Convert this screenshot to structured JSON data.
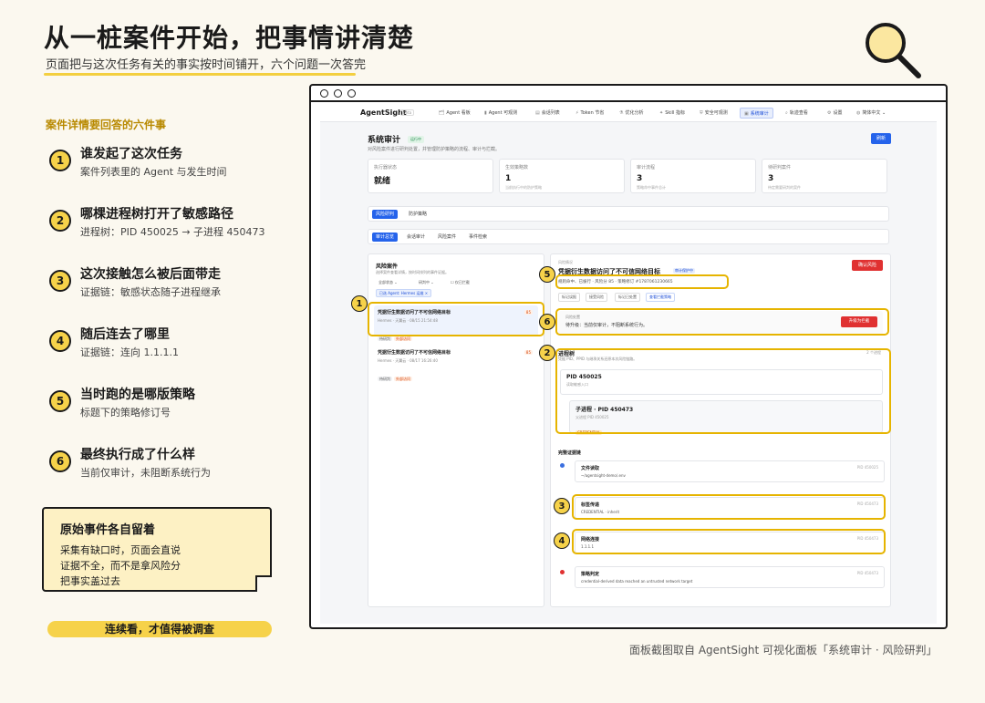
{
  "header": {
    "title": "从一桩案件开始，把事情讲清楚",
    "subtitle": "页面把与这次任务有关的事实按时间铺开，六个问题一次答完"
  },
  "questions": {
    "heading": "案件详情要回答的六件事",
    "items": [
      {
        "num": "1",
        "title": "谁发起了这次任务",
        "desc": "案件列表里的 Agent 与发生时间"
      },
      {
        "num": "2",
        "title": "哪棵进程树打开了敏感路径",
        "desc": "进程树：PID 450025 → 子进程 450473"
      },
      {
        "num": "3",
        "title": "这次接触怎么被后面带走",
        "desc": "证据链：敏感状态随子进程继承"
      },
      {
        "num": "4",
        "title": "随后连去了哪里",
        "desc": "证据链：连向 1.1.1.1"
      },
      {
        "num": "5",
        "title": "当时跑的是哪版策略",
        "desc": "标题下的策略修订号"
      },
      {
        "num": "6",
        "title": "最终执行成了什么样",
        "desc": "当前仅审计，未阻断系统行为"
      }
    ]
  },
  "note": {
    "title": "原始事件各自留着",
    "body": "采集有缺口时，页面会直说\n证据不全，而不是拿风险分\n把事实盖过去"
  },
  "pill": "连续看，才值得被调查",
  "caption": "面板截图取自 AgentSight 可视化面板「系统审计 · 风险研判」",
  "app": {
    "brand": "AgentSight",
    "brand_badge": "beta",
    "nav": [
      {
        "icon": "🗂",
        "label": "Agent 看板"
      },
      {
        "icon": "▮",
        "label": "Agent 可观测"
      },
      {
        "icon": "▤",
        "label": "会话列表"
      },
      {
        "icon": "⚡",
        "label": "Token 节省"
      },
      {
        "icon": "⚗",
        "label": "优化分析"
      },
      {
        "icon": "✦",
        "label": "Skill 指标"
      },
      {
        "icon": "⛨",
        "label": "安全可观测"
      },
      {
        "icon": "▣",
        "label": "系统审计"
      },
      {
        "icon": "⌕",
        "label": "轨迹查看"
      },
      {
        "icon": "⚙",
        "label": "设置"
      },
      {
        "icon": "◍",
        "label": "简体中文"
      }
    ],
    "page_title": "系统审计",
    "status_tag": "运行中",
    "page_desc": "对风险案件进行研判处置，并管理防护策略的流程、审计与拦截。",
    "refresh": "刷新",
    "stats": [
      {
        "label": "执行器状态",
        "value": "就绪",
        "sub": ""
      },
      {
        "label": "生效策略数",
        "value": "1",
        "sub": "当前执行中的防护策略"
      },
      {
        "label": "审计流程",
        "value": "3",
        "sub": "策略命中事件总计"
      },
      {
        "label": "待研判案件",
        "value": "3",
        "sub": "待定需要研判的案件"
      }
    ],
    "tabs1": [
      "风险研判",
      "防护策略"
    ],
    "tabs2": [
      "审计总览",
      "会话审计",
      "风险案件",
      "事件检索"
    ],
    "left": {
      "title": "风险案件",
      "desc": "选择案件查看详情，按时间排列的事件证据。",
      "filters": [
        "全部状态",
        "研判中"
      ],
      "checkbox": "仅已拦截",
      "chip": "已选 Agent: Hermes 运维 ×",
      "cases": [
        {
          "title": "凭据衍生数据访问了不可信网络目标",
          "meta": "Hermes · 天翼云 · 08/15 21:54:48",
          "tag1": "待研判",
          "tag2": "外部访问",
          "score": "85"
        },
        {
          "title": "凭据衍生数据访问了不可信网络目标",
          "meta": "Hermes · 天翼云 · 08/17 16:26:40",
          "tag1": "待研判",
          "tag2": "外部访问",
          "score": "85"
        }
      ]
    },
    "right": {
      "sublabel": "风险情况",
      "title": "凭据衍生数据访问了不可信网络目标",
      "badge": "审计保护中",
      "meta": "规则命中、已拔行 · 风险分 85 · 策略修订 #1787061230665",
      "confirm": "确认风险",
      "chips": [
        "标记误报",
        "接受风险",
        "标记已处置",
        "查看拦截策略"
      ],
      "decision_label": "风险处置",
      "decision_text": "待升级：当前仅审计，不阻断系统行为。",
      "upgrade": "升级为拦截",
      "tree_title": "进程树",
      "tree_count": "2 个进程",
      "tree_desc": "凭据 PID、PPID 与继承关系还原本次风险链路。",
      "root": {
        "name": "PID 450025",
        "sub": "读取敏感入口"
      },
      "child": {
        "name": "子进程 · PID 450473",
        "sub": "父进程 PID 450025",
        "tag": "CREDENTIAL"
      },
      "chain_title": "完整证据链",
      "events": [
        {
          "title": "文件读取",
          "detail": "~/agentsight-demo/.env",
          "pid": "PID 450025",
          "color": "#3b6fe0"
        },
        {
          "title": "标签传递",
          "detail": "CREDENTIAL · inherit",
          "pid": "PID 450473",
          "color": ""
        },
        {
          "title": "网络连接",
          "detail": "1.1.1.1",
          "pid": "PID 450473",
          "color": ""
        },
        {
          "title": "策略判定",
          "detail": "credential-derived data reached an untrusted network target",
          "pid": "PID 450473",
          "color": "#e03131"
        }
      ]
    },
    "markers": [
      "1",
      "2",
      "3",
      "4",
      "5",
      "6"
    ]
  }
}
